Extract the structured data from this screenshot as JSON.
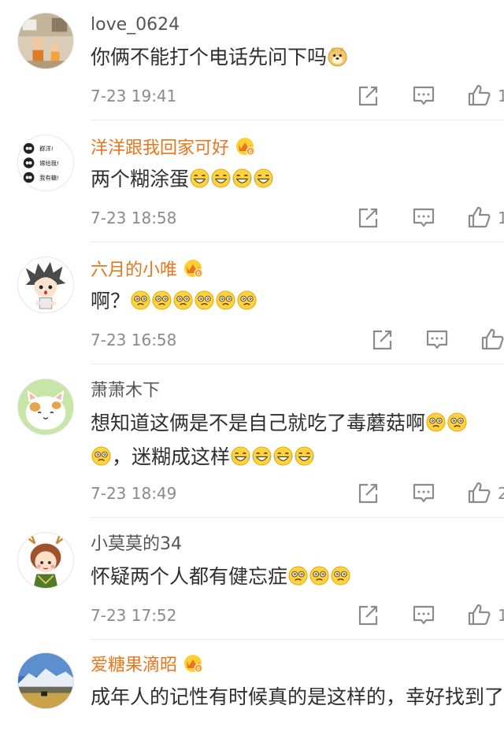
{
  "comments": [
    {
      "username": "love_0624",
      "text": "你俩不能打个电话先问下吗",
      "emoji": [
        "doge"
      ],
      "time": "7-23 19:41",
      "like_count": "1",
      "vip": false
    },
    {
      "username": "洋洋跟我回家可好",
      "text": "两个糊涂蛋",
      "emoji": [
        "laugh-cry",
        "laugh-cry",
        "laugh-cry",
        "laugh-cry"
      ],
      "time": "7-23 18:58",
      "like_count": "1",
      "vip": true,
      "avatar_lines": [
        "群洋!",
        "嫁给我!",
        "我有糖!"
      ]
    },
    {
      "username": "六月的小唯",
      "text": "啊？",
      "emoji": [
        "dizzy",
        "dizzy",
        "dizzy",
        "dizzy",
        "dizzy",
        "dizzy"
      ],
      "time": "7-23 16:58",
      "like_count": "",
      "vip": true
    },
    {
      "username": "萧萧木下",
      "text": "想知道这俩是不是自己就吃了毒蘑菇啊",
      "text2": "，迷糊成这样",
      "emoji": [
        "dizzy",
        "dizzy",
        "dizzy"
      ],
      "emoji2": [
        "laugh-cry",
        "laugh-cry",
        "laugh-cry",
        "laugh-cry"
      ],
      "time": "7-23 18:49",
      "like_count": "2",
      "vip": false
    },
    {
      "username": "小莫莫的34",
      "text": "怀疑两个人都有健忘症",
      "emoji": [
        "dizzy",
        "dizzy",
        "dizzy"
      ],
      "time": "7-23 17:52",
      "like_count": "1",
      "vip": false
    },
    {
      "username": "爱糖果滴昭",
      "text": "成年人的记性有时候真的是这样的，幸好找到了",
      "time": "",
      "like_count": "",
      "vip": true
    }
  ],
  "colors": {
    "vip_name": "#e8761d",
    "plain_name": "#555555",
    "meta": "#8b8b8b",
    "text": "#2f2f2f"
  },
  "icons": {
    "share": "share-icon",
    "reply": "reply-icon",
    "like": "like-icon",
    "badge": "vip-crown-badge-icon"
  }
}
